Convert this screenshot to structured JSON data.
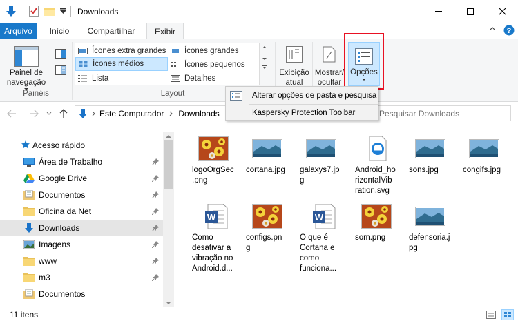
{
  "window": {
    "title": "Downloads"
  },
  "tabs": {
    "file": "Arquivo",
    "items": [
      "Início",
      "Compartilhar",
      "Exibir"
    ],
    "active": "Exibir"
  },
  "ribbon": {
    "panes": {
      "nav_pane_label": "Painel de navegação",
      "group_label": "Painéis"
    },
    "layout": {
      "items": [
        "Ícones extra grandes",
        "Ícones grandes",
        "Ícones médios",
        "Ícones pequenos",
        "Lista",
        "Detalhes"
      ],
      "selected": "Ícones médios",
      "group_label": "Layout"
    },
    "view_buttons": {
      "current_view": "Exibição atual",
      "show_hide": "Mostrar/ ocultar",
      "options": "Opções"
    }
  },
  "dropdown": {
    "items": [
      "Alterar opções de pasta e pesquisa",
      "Kaspersky Protection Toolbar"
    ]
  },
  "address": {
    "path": [
      "Este Computador",
      "Downloads"
    ],
    "search_placeholder": "Pesquisar Downloads"
  },
  "nav": {
    "quick_access": "Acesso rápido",
    "items": [
      {
        "label": "Área de Trabalho",
        "icon": "desktop-icon",
        "pinned": true
      },
      {
        "label": "Google Drive",
        "icon": "google-drive-icon",
        "pinned": true
      },
      {
        "label": "Documentos",
        "icon": "documents-icon",
        "pinned": true
      },
      {
        "label": "Oficina da Net",
        "icon": "folder-icon",
        "pinned": true
      },
      {
        "label": "Downloads",
        "icon": "downloads-icon",
        "pinned": true
      },
      {
        "label": "Imagens",
        "icon": "pictures-icon",
        "pinned": true
      },
      {
        "label": "www",
        "icon": "folder-icon",
        "pinned": true
      },
      {
        "label": "m3",
        "icon": "folder-icon",
        "pinned": true
      },
      {
        "label": "Documentos",
        "icon": "documents-icon",
        "pinned": false
      }
    ]
  },
  "files": [
    {
      "name": "logoOrgSec.png",
      "type": "flower"
    },
    {
      "name": "cortana.jpg",
      "type": "landscape"
    },
    {
      "name": "galaxys7.jpg",
      "type": "landscape"
    },
    {
      "name": "Android_horizontalVibration.svg",
      "type": "edge"
    },
    {
      "name": "sons.jpg",
      "type": "landscape"
    },
    {
      "name": "congifs.jpg",
      "type": "landscape"
    },
    {
      "name": "Como desativar a vibração no Android.d...",
      "type": "word"
    },
    {
      "name": "configs.png",
      "type": "flower"
    },
    {
      "name": "O que é Cortana e como funciona...",
      "type": "word"
    },
    {
      "name": "som.png",
      "type": "flower"
    },
    {
      "name": "defensoria.jpg",
      "type": "landscape"
    }
  ],
  "file_labels": [
    [
      "logoOrgSec",
      ".png"
    ],
    [
      "cortana.jpg"
    ],
    [
      "galaxys7.jp",
      "g"
    ],
    [
      "Android_ho",
      "rizontalVib",
      "ration.svg"
    ],
    [
      "sons.jpg"
    ],
    [
      "congifs.jpg"
    ],
    [
      "Como",
      "desativar a",
      "vibração no",
      "Android.d..."
    ],
    [
      "configs.pn",
      "g"
    ],
    [
      "O que é",
      "Cortana e",
      "como",
      "funciona..."
    ],
    [
      "som.png"
    ],
    [
      "defensoria.j",
      "pg"
    ]
  ],
  "status": {
    "item_count": "11 itens"
  },
  "colors": {
    "accent": "#1979ca",
    "highlight_box": "#e81123",
    "selection": "#cce8ff"
  }
}
